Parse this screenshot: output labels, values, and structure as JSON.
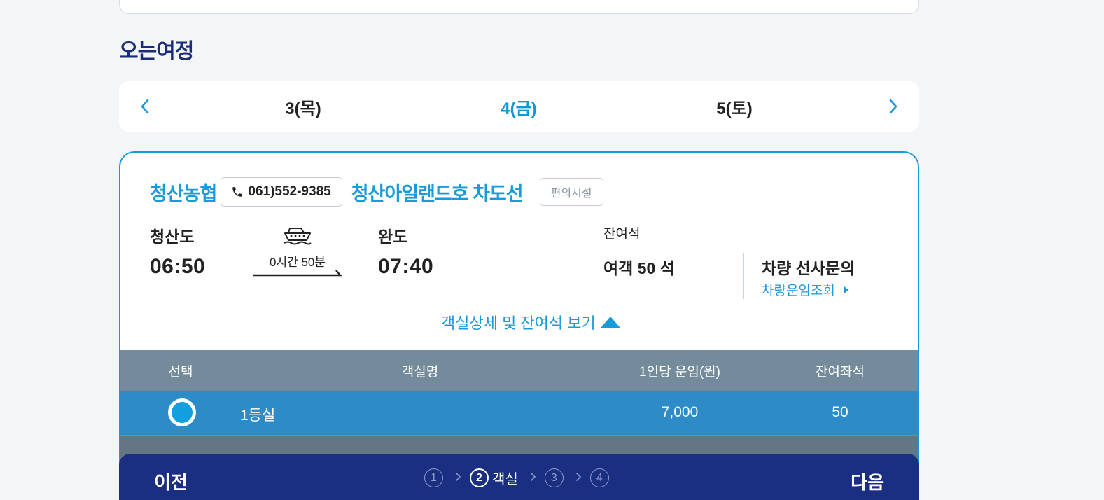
{
  "section": {
    "title": "오는여정"
  },
  "dates": [
    {
      "label": "3(목)",
      "active": false
    },
    {
      "label": "4(금)",
      "active": true
    },
    {
      "label": "5(토)",
      "active": false
    }
  ],
  "voyage": {
    "operator": "청산농협",
    "phone": "061)552-9385",
    "ship_name": "청산아일랜드호 차도선",
    "facility_button": "편의시설",
    "departure": {
      "port": "청산도",
      "time": "06:50"
    },
    "duration": "0시간 50분",
    "arrival": {
      "port": "완도",
      "time": "07:40"
    },
    "seats_title": "잔여석",
    "passenger_seats": "여객 50 석",
    "vehicle_title": "차량 선사문의",
    "vehicle_link": "차량운임조회",
    "detail_toggle": "객실상세 및 잔여석 보기"
  },
  "table": {
    "headers": [
      "선택",
      "객실명",
      "1인당 운임(원)",
      "잔여좌석"
    ],
    "rows": [
      {
        "selected": true,
        "name": "1등실",
        "fare": "7,000",
        "seats": "50"
      }
    ]
  },
  "bottom": {
    "prev": "이전",
    "next": "다음",
    "steps": [
      {
        "number": "1",
        "label": "",
        "active": false
      },
      {
        "number": "2",
        "label": "객실",
        "active": true
      },
      {
        "number": "3",
        "label": "",
        "active": false
      },
      {
        "number": "4",
        "label": "",
        "active": false
      }
    ]
  },
  "colors": {
    "accent": "#1a9bd9",
    "navy": "#1b2f82",
    "selected_row": "#2d8bc8",
    "table_head": "#748b9b"
  },
  "icons": [
    "chevron-left-icon",
    "chevron-right-icon",
    "phone-icon",
    "ship-icon",
    "caret-right-icon",
    "triangle-up-icon"
  ]
}
